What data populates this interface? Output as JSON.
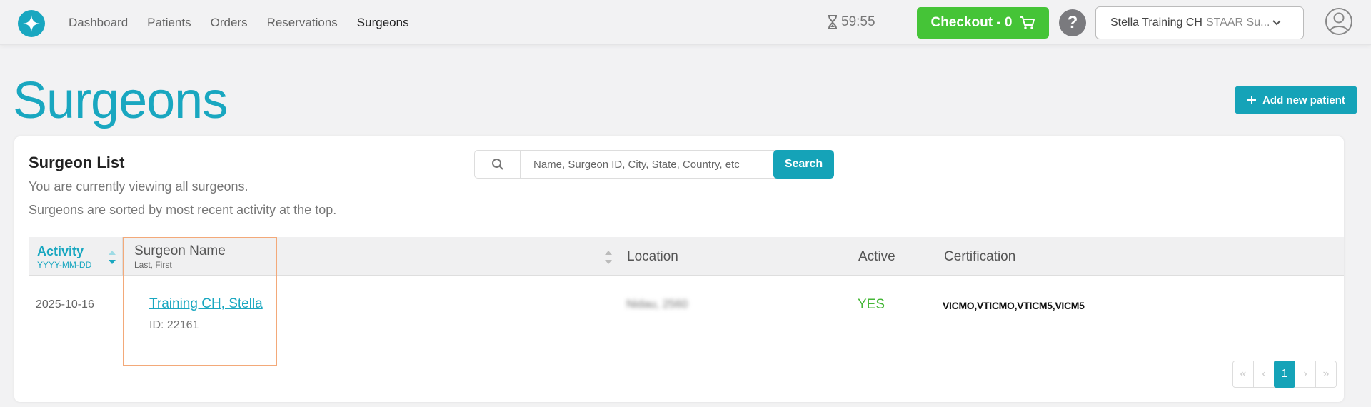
{
  "nav": {
    "items": [
      {
        "label": "Dashboard"
      },
      {
        "label": "Patients"
      },
      {
        "label": "Orders"
      },
      {
        "label": "Reservations"
      },
      {
        "label": "Surgeons"
      }
    ],
    "active_index": 4
  },
  "header": {
    "timer": "59:55",
    "checkout_label": "Checkout - 0",
    "help_label": "?",
    "account_name": "Stella Training CH",
    "account_org": "STAAR Su..."
  },
  "page": {
    "title": "Surgeons",
    "add_button_label": "Add new patient"
  },
  "card": {
    "title": "Surgeon List",
    "subtitle1": "You are currently viewing all surgeons.",
    "subtitle2": "Surgeons are sorted by most recent activity at the top.",
    "search_placeholder": "Name, Surgeon ID, City, State, Country, etc",
    "search_value": "",
    "search_button": "Search"
  },
  "table": {
    "columns": {
      "activity": {
        "label": "Activity",
        "sub": "YYYY-MM-DD"
      },
      "surgeon_name": {
        "label": "Surgeon Name",
        "sub": "Last, First"
      },
      "location": {
        "label": "Location"
      },
      "active": {
        "label": "Active"
      },
      "certification": {
        "label": "Certification"
      }
    },
    "rows": [
      {
        "date": "2025-10-16",
        "name": "Training CH, Stella",
        "id": "ID: 22161",
        "location": "Nidau, 2560",
        "active": "YES",
        "certification": "VICMO,VTICMO,VTICM5,VICM5"
      }
    ]
  },
  "pagination": {
    "first": "«",
    "prev": "‹",
    "current": "1",
    "next": "›",
    "last": "»"
  },
  "colors": {
    "brand": "#19a7c0",
    "checkout": "#45c437",
    "active_green": "#45b737",
    "highlight": "#f3a979"
  }
}
